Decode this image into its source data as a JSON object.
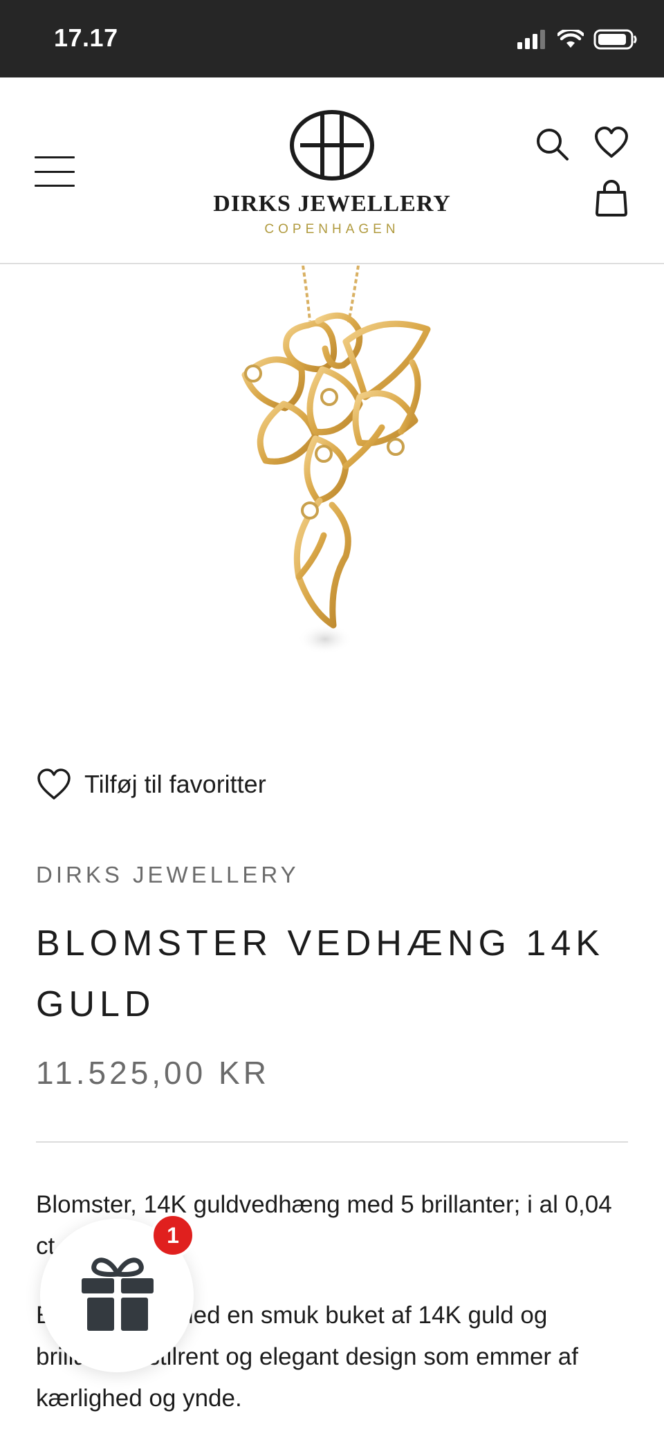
{
  "status_bar": {
    "time": "17.17",
    "icons": [
      "signal-icon",
      "wifi-icon",
      "battery-icon"
    ]
  },
  "header": {
    "brand_name": "DIRKS JEWELLERY",
    "brand_location": "COPENHAGEN",
    "icons": [
      "menu-icon",
      "search-icon",
      "heart-icon",
      "bag-icon"
    ]
  },
  "product": {
    "favorite_label": "Tilføj til favoritter",
    "vendor": "DIRKS JEWELLERY",
    "title": "BLOMSTER VEDHÆNG 14K GULD",
    "price": "11.525,00 KR",
    "description_1": "Blomster, 14K guldvedhæng med 5 brillanter; i al 0,04 ct. W.SI",
    "description_2": "Et vedhæng med en smuk buket af 14K guld og brillanter i stilrent og elegant design som emmer af kærlighed og ynde."
  },
  "gift_widget": {
    "badge_count": "1",
    "icon": "gift-icon"
  },
  "colors": {
    "status_bar_bg": "#262626",
    "brand_gold": "#b09a3e",
    "text_primary": "#1c1c1c",
    "text_secondary": "#6b6b6b",
    "badge_red": "#e0201e",
    "gift_icon": "#343a40"
  }
}
